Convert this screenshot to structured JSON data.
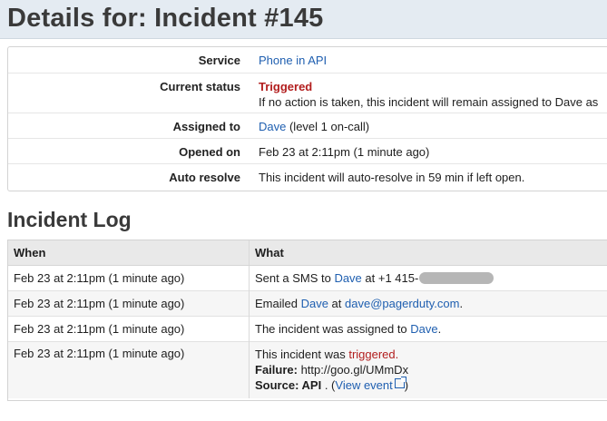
{
  "header": {
    "title": "Details for: Incident #145"
  },
  "details": {
    "service": {
      "label": "Service",
      "value": "Phone in API"
    },
    "status": {
      "label": "Current status",
      "value": "Triggered",
      "note": "If no action is taken, this incident will remain assigned to Dave as"
    },
    "assigned": {
      "label": "Assigned to",
      "user": "Dave",
      "suffix": " (level 1 on-call)"
    },
    "opened": {
      "label": "Opened on",
      "value": "Feb 23 at 2:11pm (1 minute ago)"
    },
    "auto_resolve": {
      "label": "Auto resolve",
      "value": "This incident will auto-resolve in 59 min if left open."
    }
  },
  "log": {
    "heading": "Incident Log",
    "columns": {
      "when": "When",
      "what": "What"
    },
    "rows": [
      {
        "when": "Feb 23 at 2:11pm (1 minute ago)",
        "a": "Sent a SMS to ",
        "user": "Dave",
        "b": " at +1 415-"
      },
      {
        "when": "Feb 23 at 2:11pm (1 minute ago)",
        "a": "Emailed ",
        "user": "Dave",
        "b": " at ",
        "email": "dave@pagerduty.com",
        "c": "."
      },
      {
        "when": "Feb 23 at 2:11pm (1 minute ago)",
        "a": "The incident was assigned to ",
        "user": "Dave",
        "c": "."
      },
      {
        "when": "Feb 23 at 2:11pm (1 minute ago)",
        "a": "This incident was ",
        "status": "triggered",
        "c": ".",
        "failure_label": "Failure:",
        "failure_value": " http://goo.gl/UMmDx",
        "source_label": "Source:",
        "source_value": " API",
        "source_mid": " . (",
        "view_event": "View event",
        "source_end": ")"
      }
    ]
  },
  "colors": {
    "link": "#1f5fb0",
    "triggered": "#b21d1d",
    "header_bg": "#e4ebf2"
  }
}
